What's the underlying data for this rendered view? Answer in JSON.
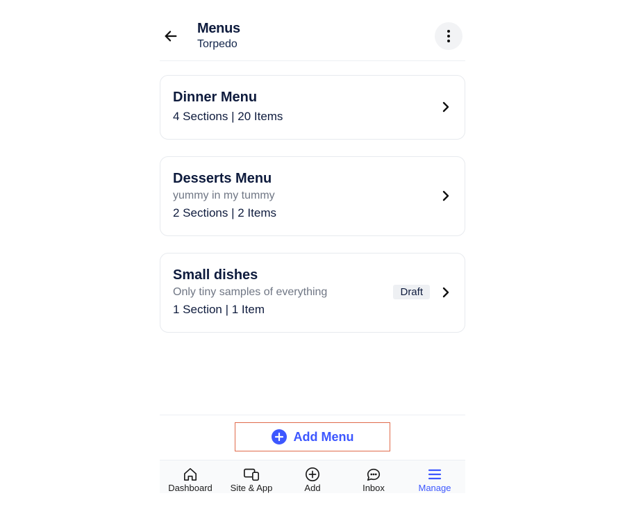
{
  "header": {
    "title": "Menus",
    "subtitle": "Torpedo"
  },
  "menus": [
    {
      "title": "Dinner Menu",
      "desc": null,
      "meta": "4 Sections | 20 Items",
      "badge": null
    },
    {
      "title": "Desserts Menu",
      "desc": "yummy in my tummy",
      "meta": "2 Sections | 2 Items",
      "badge": null
    },
    {
      "title": "Small dishes",
      "desc": "Only tiny samples of everything",
      "meta": "1 Section | 1 Item",
      "badge": "Draft"
    }
  ],
  "add_button": {
    "label": "Add Menu"
  },
  "tabs": [
    {
      "label": "Dashboard",
      "active": false
    },
    {
      "label": "Site & App",
      "active": false
    },
    {
      "label": "Add",
      "active": false
    },
    {
      "label": "Inbox",
      "active": false
    },
    {
      "label": "Manage",
      "active": true
    }
  ]
}
